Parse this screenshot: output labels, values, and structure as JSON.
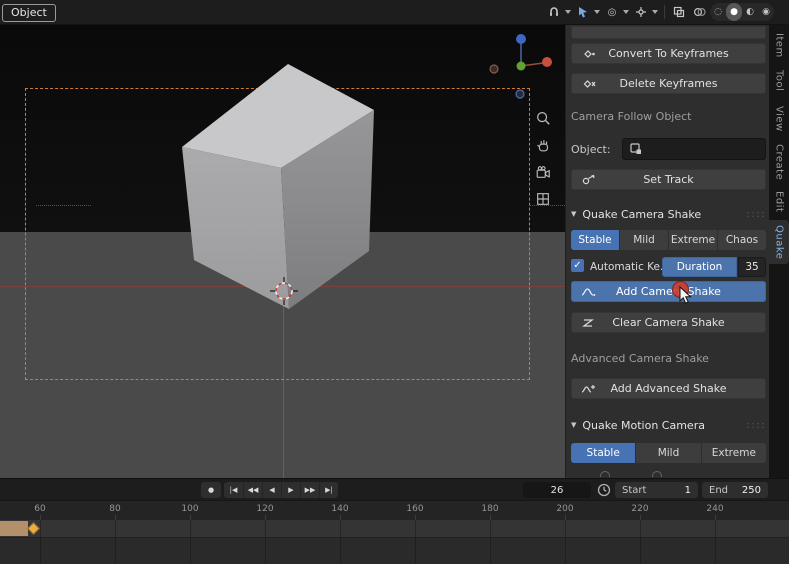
{
  "colors": {
    "accent_blue": "#4772b3",
    "hover_button_blue": "#4b74ad",
    "camera_border_orange": "#cf7b33",
    "keyframe_orange": "#f0ac40",
    "range_bar_tan": "#b3906a",
    "click_indicator_red": "#cc3e2e",
    "panel_bg": "#2e2e2e"
  },
  "header": {
    "object_menu_label": "Object"
  },
  "icons_glyphs": {
    "checkmark": "✓",
    "collapse_triangle": "▼",
    "panel_grip": "::::",
    "proportional": "◎",
    "shading_wireframe": "◌",
    "shading_solid": "●",
    "shading_material": "◐",
    "shading_rendered": "◉"
  },
  "sidebar": {
    "buttons": {
      "convert": "Convert To Keyframes",
      "delete": "Delete Keyframes",
      "set_track": "Set Track"
    },
    "camera_follow": {
      "section_label": "Camera Follow Object",
      "object_label": "Object:"
    },
    "quake_camera_shake": {
      "title": "Quake Camera Shake",
      "presets": [
        "Stable",
        "Mild",
        "Extreme",
        "Chaos"
      ],
      "active_preset": "Stable",
      "automatic_label": "Automatic Ke..",
      "duration_label": "Duration",
      "duration_value": "35",
      "add_button": "Add Camera Shake",
      "clear_button": "Clear Camera Shake",
      "advanced_label": "Advanced Camera Shake",
      "add_advanced_button": "Add Advanced Shake"
    },
    "quake_motion_camera": {
      "title": "Quake Motion Camera",
      "presets": [
        "Stable",
        "Mild",
        "Extreme"
      ],
      "active_preset": "Stable"
    },
    "tabs": [
      "Item",
      "Tool",
      "View",
      "Create",
      "Edit",
      "Quake"
    ],
    "active_tab": "Quake"
  },
  "timeline": {
    "record_glyph": "●",
    "transport_buttons": [
      "|◀",
      "◀◀",
      "◀",
      "▶",
      "▶▶",
      "▶|"
    ],
    "current_frame": "26",
    "start": {
      "label": "Start",
      "value": "1"
    },
    "end": {
      "label": "End",
      "value": "250"
    },
    "ruler_frames": [
      "60",
      "80",
      "100",
      "120",
      "140",
      "160",
      "180",
      "200",
      "220",
      "240"
    ]
  }
}
